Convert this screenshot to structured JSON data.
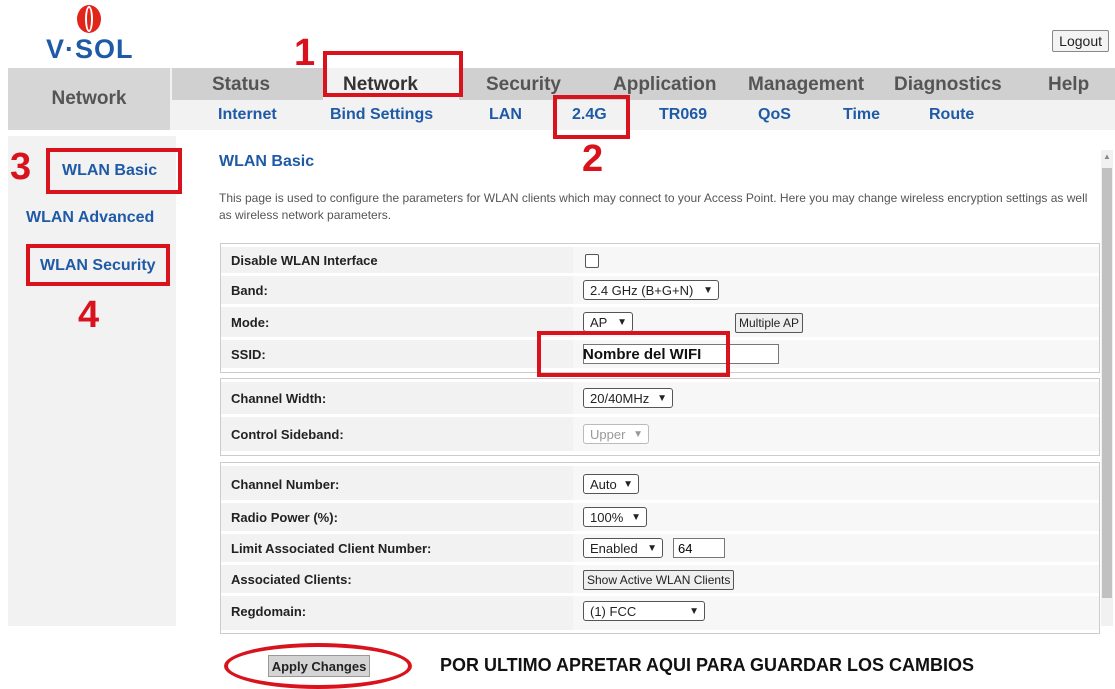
{
  "header": {
    "logo_text": "V·SOL",
    "logout_label": "Logout"
  },
  "nav": {
    "section_label": "Network",
    "main_tabs": [
      "Status",
      "Network",
      "Security",
      "Application",
      "Management",
      "Diagnostics",
      "Help"
    ],
    "active_main_tab": "Network",
    "sub_tabs": [
      "Internet",
      "Bind Settings",
      "LAN",
      "2.4G",
      "TR069",
      "QoS",
      "Time",
      "Route"
    ],
    "active_sub_tab": "2.4G"
  },
  "sidebar": {
    "items": [
      "WLAN Basic",
      "WLAN Advanced",
      "WLAN Security"
    ]
  },
  "page": {
    "title": "WLAN Basic",
    "description": "This page is used to configure the parameters for WLAN clients which may connect to your Access Point. Here you may change wireless encryption settings as well as wireless network parameters."
  },
  "form": {
    "disable_wlan_label": "Disable WLAN Interface",
    "disable_wlan_checked": false,
    "band_label": "Band:",
    "band_value": "2.4 GHz (B+G+N)",
    "mode_label": "Mode:",
    "mode_value": "AP",
    "multiple_ap_label": "Multiple AP",
    "ssid_label": "SSID:",
    "channel_width_label": "Channel Width:",
    "channel_width_value": "20/40MHz",
    "control_sideband_label": "Control Sideband:",
    "control_sideband_value": "Upper",
    "channel_number_label": "Channel Number:",
    "channel_number_value": "Auto",
    "radio_power_label": "Radio Power (%):",
    "radio_power_value": "100%",
    "limit_clients_label": "Limit Associated Client Number:",
    "limit_clients_value": "Enabled",
    "limit_clients_number": "64",
    "associated_clients_label": "Associated Clients:",
    "show_clients_label": "Show Active WLAN Clients",
    "regdomain_label": "Regdomain:",
    "regdomain_value": "(1) FCC"
  },
  "footer": {
    "apply_label": "Apply Changes"
  },
  "annotations": {
    "numbers": [
      "1",
      "2",
      "3",
      "4"
    ],
    "ssid_note": "Nombre del WIFI",
    "final_note": "POR ULTIMO APRETAR AQUI PARA GUARDAR LOS CAMBIOS",
    "color": "#d9131d"
  },
  "colors": {
    "link_blue": "#1f5aa6",
    "annotation_red": "#d9131d"
  },
  "icons": [
    "vsol-logo-icon",
    "chevron-down-icon",
    "checkbox-icon"
  ]
}
